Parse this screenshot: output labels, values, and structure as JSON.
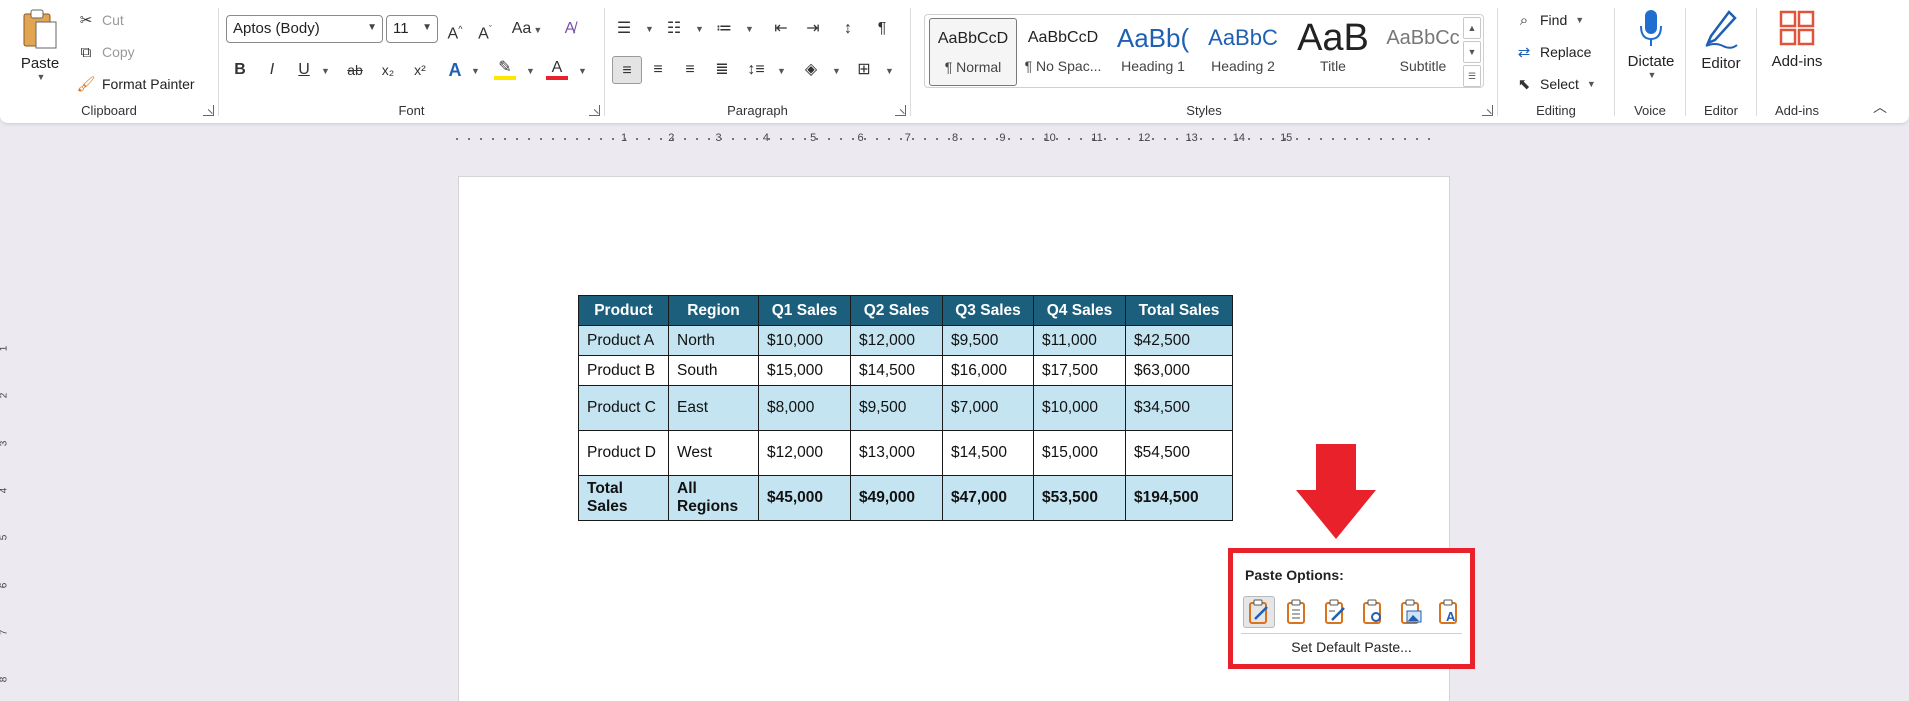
{
  "clipboard": {
    "paste": "Paste",
    "cut": "Cut",
    "copy": "Copy",
    "format_painter": "Format Painter",
    "label": "Clipboard"
  },
  "font": {
    "family": "Aptos (Body)",
    "size": "11",
    "label": "Font",
    "case_btn": "Aa",
    "bold": "B",
    "italic": "I",
    "underline": "U",
    "strike": "ab",
    "subscript": "x₂",
    "superscript": "x²",
    "text_effects": "A",
    "font_color": "A",
    "grow": "A^",
    "shrink": "Aˇ"
  },
  "paragraph": {
    "label": "Paragraph"
  },
  "styles": {
    "label": "Styles",
    "items": [
      {
        "sample": "AaBbCcD",
        "name": "¶ Normal"
      },
      {
        "sample": "AaBbCcD",
        "name": "¶ No Spac..."
      },
      {
        "sample": "AaBb(",
        "name": "Heading 1"
      },
      {
        "sample": "AaBbC",
        "name": "Heading 2"
      },
      {
        "sample": "AaB",
        "name": "Title"
      },
      {
        "sample": "AaBbCc",
        "name": "Subtitle"
      }
    ]
  },
  "editing": {
    "label": "Editing",
    "find": "Find",
    "replace": "Replace",
    "select": "Select"
  },
  "voice": {
    "label": "Voice",
    "dictate": "Dictate"
  },
  "editor": {
    "label": "Editor",
    "button": "Editor"
  },
  "addins": {
    "label": "Add-ins",
    "button": "Add-ins"
  },
  "ruler": {
    "marks": [
      "1",
      "2",
      "3",
      "4",
      "5",
      "6",
      "7",
      "8",
      "9",
      "10",
      "11",
      "12",
      "13",
      "14",
      "15"
    ]
  },
  "vruler": {
    "marks": [
      "1",
      "2",
      "3",
      "4",
      "5",
      "6",
      "7",
      "8"
    ]
  },
  "table": {
    "headers": [
      "Product",
      "Region",
      "Q1 Sales",
      "Q2 Sales",
      "Q3 Sales",
      "Q4 Sales",
      "Total Sales"
    ],
    "rows": [
      [
        "Product A",
        "North",
        "$10,000",
        "$12,000",
        "$9,500",
        "$11,000",
        "$42,500"
      ],
      [
        "Product B",
        "South",
        "$15,000",
        "$14,500",
        "$16,000",
        "$17,500",
        "$63,000"
      ],
      [
        "Product C",
        "East",
        "$8,000",
        "$9,500",
        "$7,000",
        "$10,000",
        "$34,500"
      ],
      [
        "Product D",
        "West",
        "$12,000",
        "$13,000",
        "$14,500",
        "$15,000",
        "$54,500"
      ],
      [
        "Total Sales",
        "All Regions",
        "$45,000",
        "$49,000",
        "$47,000",
        "$53,500",
        "$194,500"
      ]
    ]
  },
  "paste_options": {
    "title": "Paste Options:",
    "set_default": "Set Default Paste..."
  },
  "colors": {
    "header_bg": "#1c5f7c",
    "band_bg": "#c3e4f0",
    "highlight": "#e8212b",
    "accent_orange": "#d9731e",
    "accent_blue": "#1f5fb4"
  }
}
